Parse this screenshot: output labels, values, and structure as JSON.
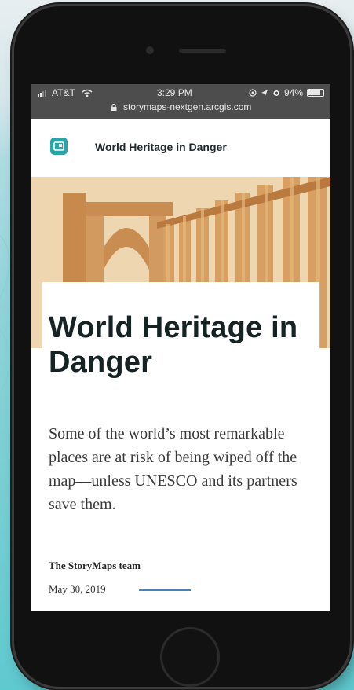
{
  "status_bar": {
    "carrier": "AT&T",
    "time": "3:29 PM",
    "battery": "94%",
    "battery_level": 0.94,
    "url": "storymaps-nextgen.arcgis.com"
  },
  "header": {
    "title": "World Heritage in Danger"
  },
  "story": {
    "title": "World Heritage in Danger",
    "summary": "Some of the world’s most remarkable places are at risk of being wiped off the map—unless UNESCO and its partners save them.",
    "author": "The StoryMaps team",
    "date": "May 30, 2019"
  },
  "colors": {
    "accent": "#2aa5a8",
    "date_line": "#4a81b9",
    "statusbar_bg": "#4d4d4d",
    "title_text": "#152325"
  },
  "icons": [
    "signal-icon",
    "wifi-icon",
    "location-icon",
    "alarm-icon",
    "battery-icon",
    "lock-icon",
    "storymaps-logo-icon"
  ]
}
